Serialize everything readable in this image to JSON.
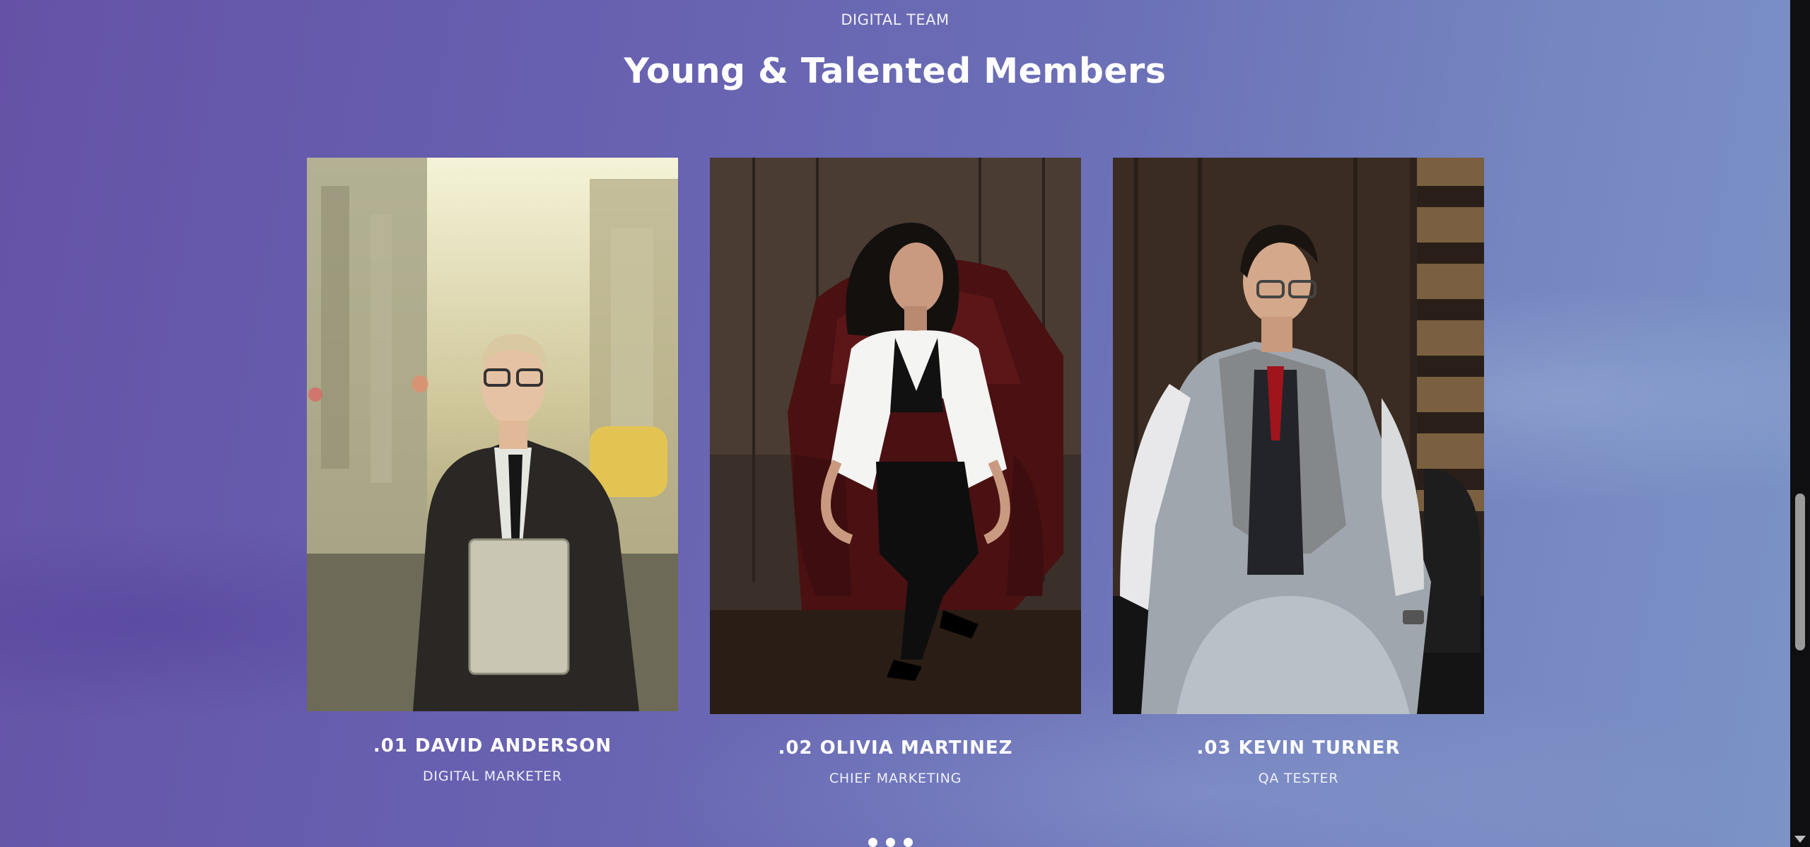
{
  "section": {
    "eyebrow": "DIGITAL TEAM",
    "title": "Young & Talented Members"
  },
  "members": [
    {
      "name": ".01 DAVID ANDERSON",
      "role": "DIGITAL MARKETER",
      "photo_description_icon": "man-in-suit-with-laptop-photo"
    },
    {
      "name": ".02 OLIVIA MARTINEZ",
      "role": "CHIEF MARKETING",
      "photo_description_icon": "woman-in-armchair-photo"
    },
    {
      "name": ".03 KEVIN TURNER",
      "role": "QA TESTER",
      "photo_description_icon": "man-in-grey-vest-photo"
    }
  ],
  "carousel": {
    "dot_count": 3,
    "active_index": 0
  },
  "colors": {
    "background_left": "#6552a6",
    "background_right": "#7c94c7",
    "text": "#ffffff"
  }
}
